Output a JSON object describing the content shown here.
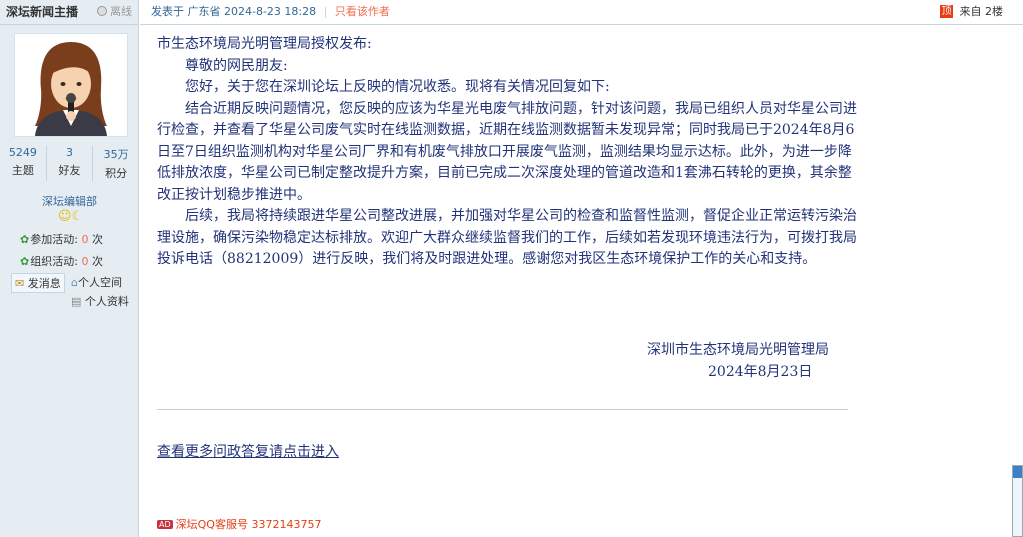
{
  "sidebar": {
    "author": "深坛新闻主播",
    "status": "离线",
    "stats": [
      {
        "num": "5249",
        "label": "主题"
      },
      {
        "num": "3",
        "label": "好友"
      },
      {
        "num": "35万",
        "label": "积分"
      }
    ],
    "group": "深坛编辑部",
    "activities": [
      {
        "label": "参加活动:",
        "count": "0",
        "unit": "次"
      },
      {
        "label": "组织活动:",
        "count": "0",
        "unit": "次"
      }
    ],
    "send_message": "发消息",
    "personal_space": "个人空间",
    "personal_info": "个人资料"
  },
  "post": {
    "posted_at": "发表于 广东省 2024-8-23 18:28",
    "only_author": "只看该作者",
    "floor_badge": "顶",
    "floor_text": "来自 2楼",
    "body": {
      "p1": "市生态环境局光明管理局授权发布:",
      "p2": "尊敬的网民朋友:",
      "p3": "您好，关于您在深圳论坛上反映的情况收悉。现将有关情况回复如下:",
      "p4": "结合近期反映问题情况，您反映的应该为华星光电废气排放问题，针对该问题，我局已组织人员对华星公司进行检查，并查看了华星公司废气实时在线监测数据，近期在线监测数据暂未发现异常；同时我局已于2024年8月6日至7日组织监测机构对华星公司厂界和有机废气排放口开展废气监测，监测结果均显示达标。此外，为进一步降低排放浓度，华星公司已制定整改提升方案，目前已完成二次深度处理的管道改造和1套沸石转轮的更换，其余整改正按计划稳步推进中。",
      "p5": "后续，我局将持续跟进华星公司整改进展，并加强对华星公司的检查和监督性监测，督促企业正常运转污染治理设施，确保污染物稳定达标排放。欢迎广大群众继续监督我们的工作，后续如若发现环境违法行为，可拨打我局投诉电话（88212009）进行反映，我们将及时跟进处理。感谢您对我区生态环境保护工作的关心和支持。",
      "signature": "深圳市生态环境局光明管理局",
      "date": "2024年8月23日"
    },
    "more_link": "查看更多问政答复请点击进入",
    "qq_service": "深坛QQ客服号 3372143757",
    "ad_label": "AD"
  },
  "colors": {
    "sidebar_bg": "#e5edf2",
    "border": "#c2d5e3",
    "link": "#336699",
    "body_text": "#22337a",
    "accent_red": "#e83d14"
  }
}
